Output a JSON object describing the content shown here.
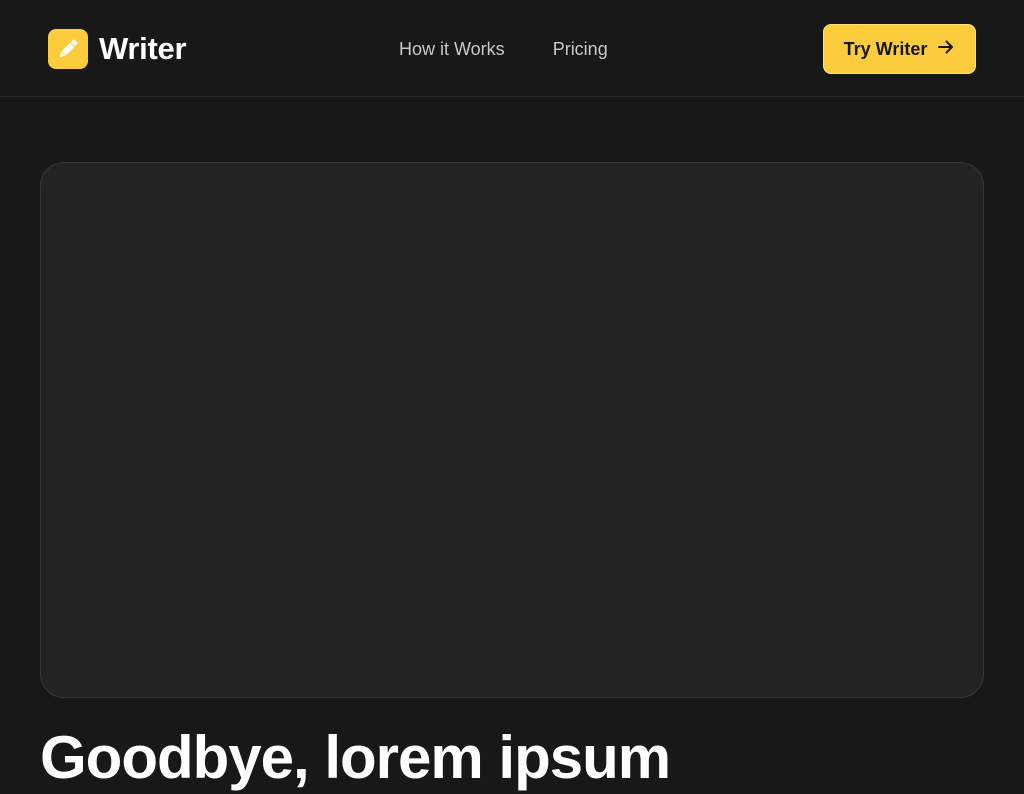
{
  "brand": {
    "name": "Writer",
    "accent_color": "#fbcd3c",
    "logo_icon": "pencil-icon"
  },
  "nav": {
    "items": [
      {
        "label": "How it Works"
      },
      {
        "label": "Pricing"
      }
    ]
  },
  "cta": {
    "label": "Try Writer",
    "icon": "arrow-right-icon"
  },
  "hero": {
    "headline": "Goodbye, lorem ipsum"
  }
}
